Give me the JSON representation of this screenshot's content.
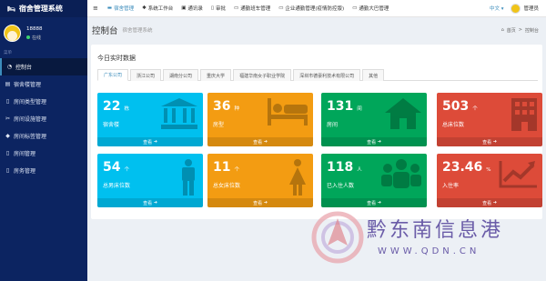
{
  "app": {
    "title": "宿舍管理系统"
  },
  "user": {
    "name": "18888",
    "status": "在线"
  },
  "sidebar": {
    "header": "菜单",
    "items": [
      {
        "label": "控制台",
        "icon": "dashboard-icon"
      },
      {
        "label": "宿舍楼管理",
        "icon": "building-icon"
      },
      {
        "label": "房间类型管理",
        "icon": "file-icon"
      },
      {
        "label": "房间设施管理",
        "icon": "tools-icon"
      },
      {
        "label": "房间标签管理",
        "icon": "tag-icon"
      },
      {
        "label": "房间管理",
        "icon": "file-icon"
      },
      {
        "label": "房务管理",
        "icon": "file-icon"
      }
    ]
  },
  "topbar": {
    "items": [
      {
        "label": "宿舍管理",
        "icon": "bed-icon"
      },
      {
        "label": "系统工作台",
        "icon": "gear-icon"
      },
      {
        "label": "通讯录",
        "icon": "addressbook-icon"
      },
      {
        "label": "审批",
        "icon": "file-icon"
      },
      {
        "label": "通勤班车管理",
        "icon": "bus-icon"
      },
      {
        "label": "企业通勤管理(疫情防控版)",
        "icon": "bus-icon"
      },
      {
        "label": "通勤大巴管理",
        "icon": "bus-icon"
      }
    ],
    "lang": "中文",
    "admin": "管理员"
  },
  "content": {
    "title": "控制台",
    "subtitle": "宿舍管理系统",
    "breadcrumb": [
      "首页",
      "控制台"
    ]
  },
  "panel": {
    "title": "今日实时数据",
    "tabs": [
      "广东公司",
      "浙江公司",
      "湖南分公司",
      "重庆大学",
      "福建华南女子职业学院",
      "深圳市德豪利技术有限公司",
      "其他"
    ]
  },
  "cards": [
    {
      "num": "22",
      "unit": "栋",
      "label": "宿舍楼",
      "more": "查看",
      "color": "#00c0ef",
      "icon": "institution-icon"
    },
    {
      "num": "36",
      "unit": "种",
      "label": "房型",
      "more": "查看",
      "color": "#f39c12",
      "icon": "bed-icon"
    },
    {
      "num": "131",
      "unit": "间",
      "label": "房间",
      "more": "查看",
      "color": "#00a65a",
      "icon": "home-icon"
    },
    {
      "num": "503",
      "unit": "个",
      "label": "总床位数",
      "more": "查看",
      "color": "#dd4b39",
      "icon": "building-icon"
    },
    {
      "num": "54",
      "unit": "个",
      "label": "总男床位数",
      "more": "查看",
      "color": "#00c0ef",
      "icon": "male-icon"
    },
    {
      "num": "11",
      "unit": "个",
      "label": "总女床位数",
      "more": "查看",
      "color": "#f39c12",
      "icon": "female-icon"
    },
    {
      "num": "118",
      "unit": "人",
      "label": "已入住人数",
      "more": "查看",
      "color": "#00a65a",
      "icon": "users-icon"
    },
    {
      "num": "23.46",
      "unit": "%",
      "label": "入住率",
      "more": "查看",
      "color": "#dd4b39",
      "icon": "line-chart-icon"
    }
  ],
  "watermark": {
    "text": "黔东南信息港",
    "url": "WWW.QDN.CN"
  }
}
